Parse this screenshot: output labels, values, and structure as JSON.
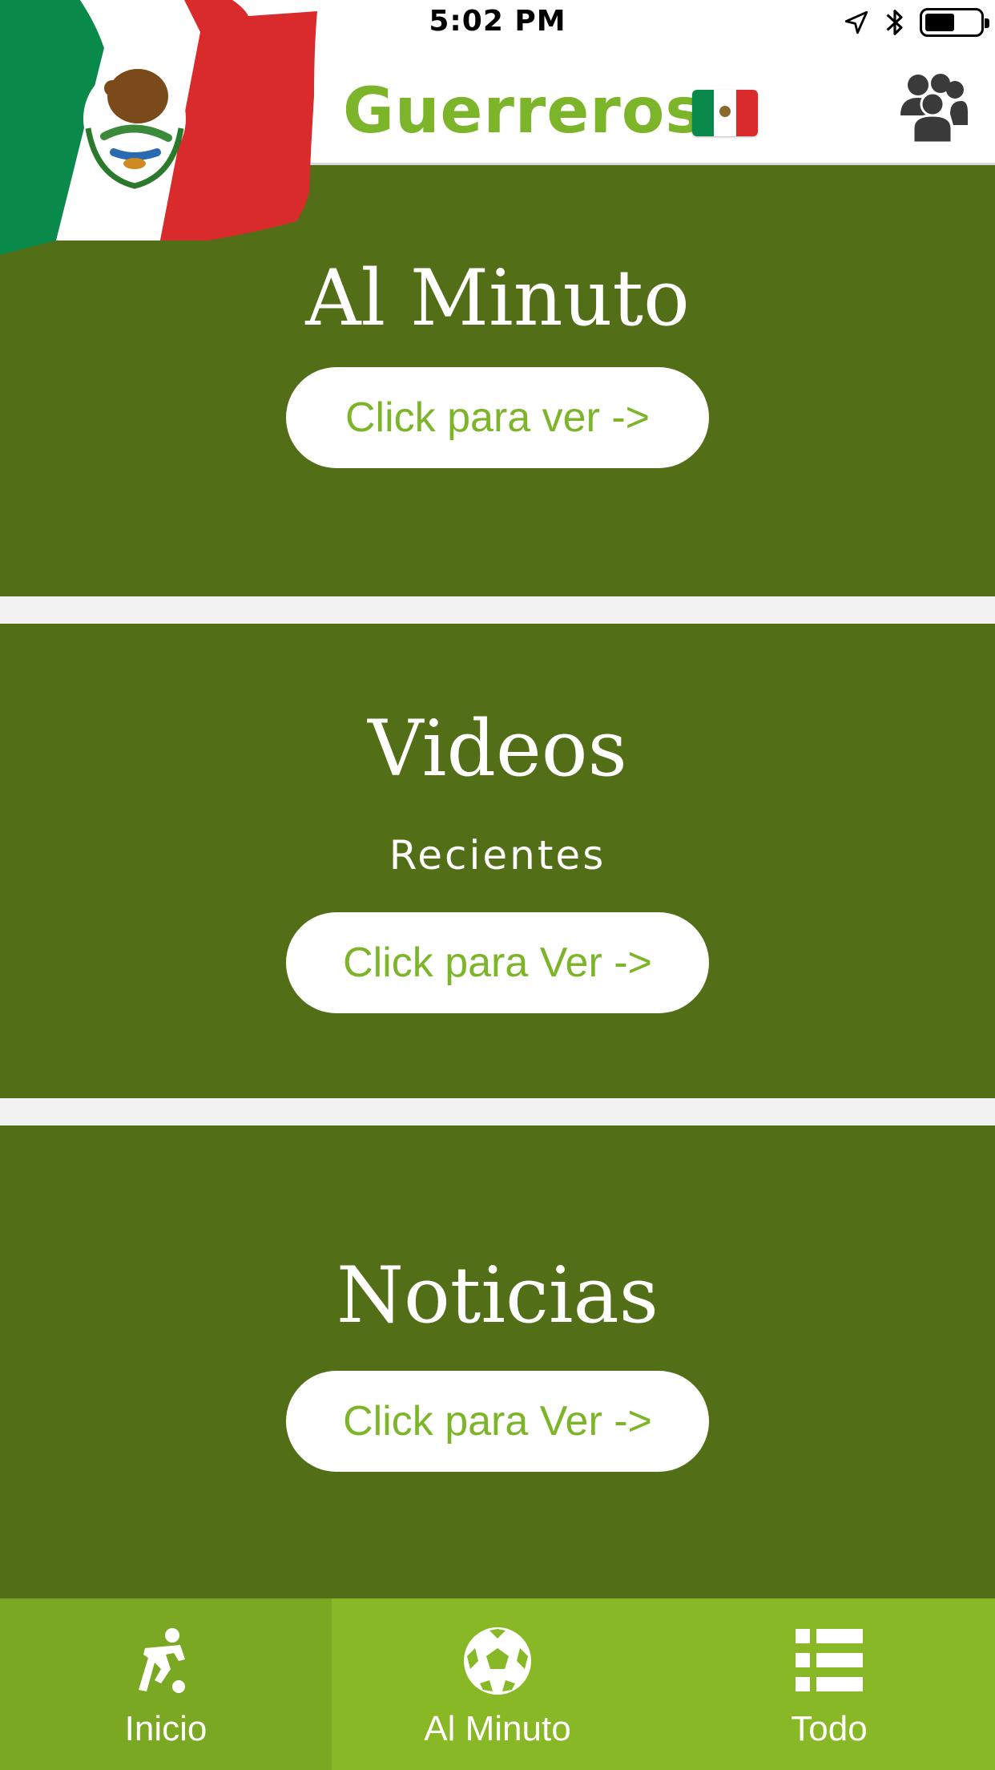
{
  "status_bar": {
    "time": "5:02 PM",
    "icons": [
      "location-arrow-icon",
      "bluetooth-icon",
      "battery-icon"
    ]
  },
  "header": {
    "title": "Guerreros",
    "title_flag_icon": "mexico-flag-emoji-icon",
    "logo_icon": "mexico-flag-icon",
    "right_icon": "users-group-icon"
  },
  "sections": [
    {
      "title": "Al Minuto",
      "subtitle": "",
      "button_label": "Click para ver ->"
    },
    {
      "title": "Videos",
      "subtitle": "Recientes",
      "button_label": "Click para Ver ->"
    },
    {
      "title": "Noticias",
      "subtitle": "",
      "button_label": "Click para Ver ->"
    }
  ],
  "tabbar": {
    "tabs": [
      {
        "label": "Inicio",
        "icon": "soccer-player-icon",
        "active": true
      },
      {
        "label": "Al Minuto",
        "icon": "soccer-ball-icon",
        "active": false
      },
      {
        "label": "Todo",
        "icon": "list-icon",
        "active": false
      }
    ]
  },
  "colors": {
    "brand_green": "#7db52a",
    "section_bg": "#526f18",
    "tabbar_bg": "#88b825",
    "tab_active_bg": "#7aa823",
    "flag_green": "#0a8a4a",
    "flag_red": "#d92b2b"
  }
}
